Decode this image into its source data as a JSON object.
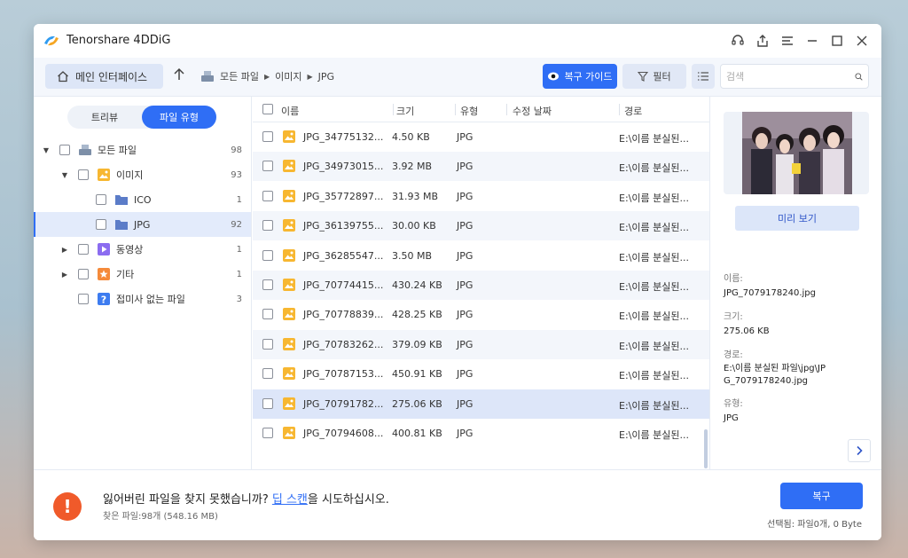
{
  "app": {
    "title": "Tenorshare 4DDiG"
  },
  "toolbar": {
    "home_label": "메인 인터페이스",
    "breadcrumbs": [
      "모든 파일",
      "이미지",
      "JPG"
    ],
    "guide_label": "복구 가이드",
    "filter_label": "필터",
    "search_placeholder": "검색"
  },
  "sidebar": {
    "tabs": [
      {
        "label": "트리뷰",
        "active": false
      },
      {
        "label": "파일 유형",
        "active": true
      }
    ],
    "tree": [
      {
        "label": "모든 파일",
        "count": "98",
        "icon": "drive-icon"
      },
      {
        "label": "이미지",
        "count": "93",
        "icon": "image-folder-icon"
      },
      {
        "label": "ICO",
        "count": "1",
        "icon": "folder-icon"
      },
      {
        "label": "JPG",
        "count": "92",
        "icon": "folder-icon",
        "selected": true
      },
      {
        "label": "동영상",
        "count": "1",
        "icon": "video-icon"
      },
      {
        "label": "기타",
        "count": "1",
        "icon": "other-icon"
      },
      {
        "label": "접미사 없는 파일",
        "count": "3",
        "icon": "unknown-file-icon"
      }
    ]
  },
  "filelist": {
    "headers": {
      "name": "이름",
      "size": "크기",
      "type": "유형",
      "modified": "수정 날짜",
      "path": "경로"
    },
    "rows": [
      {
        "name": "JPG_34775132...",
        "size": "4.50 KB",
        "type": "JPG",
        "modified": "",
        "path": "E:\\이름 분실된..."
      },
      {
        "name": "JPG_34973015...",
        "size": "3.92 MB",
        "type": "JPG",
        "modified": "",
        "path": "E:\\이름 분실된..."
      },
      {
        "name": "JPG_35772897...",
        "size": "31.93 MB",
        "type": "JPG",
        "modified": "",
        "path": "E:\\이름 분실된..."
      },
      {
        "name": "JPG_36139755...",
        "size": "30.00 KB",
        "type": "JPG",
        "modified": "",
        "path": "E:\\이름 분실된..."
      },
      {
        "name": "JPG_36285547...",
        "size": "3.50 MB",
        "type": "JPG",
        "modified": "",
        "path": "E:\\이름 분실된..."
      },
      {
        "name": "JPG_70774415...",
        "size": "430.24 KB",
        "type": "JPG",
        "modified": "",
        "path": "E:\\이름 분실된..."
      },
      {
        "name": "JPG_70778839...",
        "size": "428.25 KB",
        "type": "JPG",
        "modified": "",
        "path": "E:\\이름 분실된..."
      },
      {
        "name": "JPG_70783262...",
        "size": "379.09 KB",
        "type": "JPG",
        "modified": "",
        "path": "E:\\이름 분실된..."
      },
      {
        "name": "JPG_70787153...",
        "size": "450.91 KB",
        "type": "JPG",
        "modified": "",
        "path": "E:\\이름 분실된..."
      },
      {
        "name": "JPG_70791782...",
        "size": "275.06 KB",
        "type": "JPG",
        "modified": "",
        "path": "E:\\이름 분실된...",
        "selected": true
      },
      {
        "name": "JPG_70794608...",
        "size": "400.81 KB",
        "type": "JPG",
        "modified": "",
        "path": "E:\\이름 분실된..."
      }
    ]
  },
  "preview": {
    "button_label": "미리 보기",
    "name_label": "이름:",
    "name_value": "JPG_7079178240.jpg",
    "size_label": "크기:",
    "size_value": "275.06 KB",
    "path_label": "경로:",
    "path_value": "E:\\이름 분실된 파일\\jpg\\JPG_7079178240.jpg",
    "type_label": "유형:",
    "type_value": "JPG"
  },
  "bottom": {
    "message_before": "잃어버린 파일을 찾지 못했습니까? ",
    "message_link": "딥 스캔",
    "message_after": "을 시도하십시오.",
    "found": "찾은 파일:98개 (548.16 MB)",
    "recover_label": "복구",
    "selected_info": "선택됨: 파일0개, 0 Byte"
  },
  "colors": {
    "accent": "#2f6ef5",
    "alert": "#f05a2a",
    "selection": "#dde6f9"
  }
}
